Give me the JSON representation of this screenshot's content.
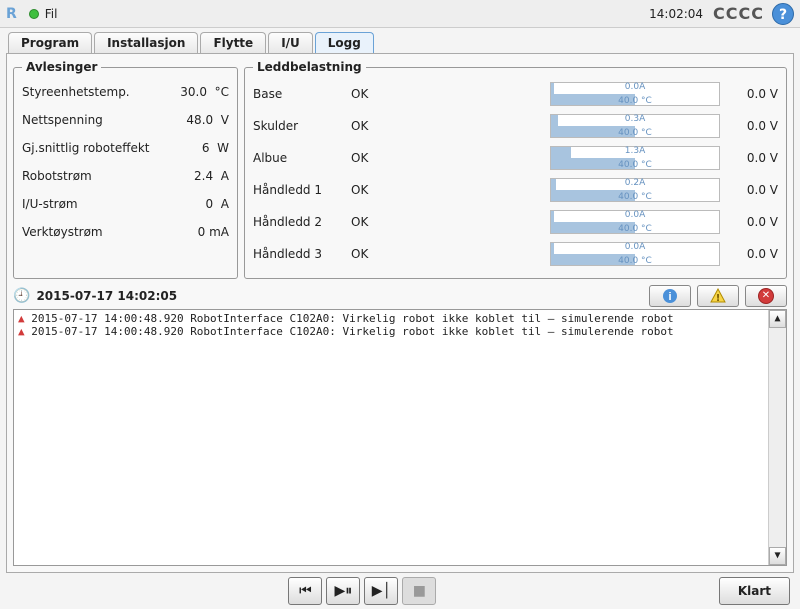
{
  "header": {
    "logo": "R",
    "menu_file": "Fil",
    "clock": "14:02:04",
    "brand": "CCCC",
    "help": "?"
  },
  "tabs": {
    "program": "Program",
    "installation": "Installasjon",
    "move": "Flytte",
    "io": "I/U",
    "log": "Logg"
  },
  "readings": {
    "title": "Avlesinger",
    "controller_temp_label": "Styreenhetstemp.",
    "controller_temp_value": "30.0",
    "controller_temp_unit": "°C",
    "main_voltage_label": "Nettspenning",
    "main_voltage_value": "48.0",
    "main_voltage_unit": "V",
    "avg_power_label": "Gj.snittlig roboteffekt",
    "avg_power_value": "6",
    "avg_power_unit": "W",
    "robot_current_label": "Robotstrøm",
    "robot_current_value": "2.4",
    "robot_current_unit": "A",
    "io_current_label": "I/U-strøm",
    "io_current_value": "0",
    "io_current_unit": "A",
    "tool_current_label": "Verktøystrøm",
    "tool_current_value": "0",
    "tool_current_unit": "mA"
  },
  "joints": {
    "title": "Leddbelastning",
    "rows": [
      {
        "name": "Base",
        "status": "OK",
        "amps": "0.0A",
        "temp": "40.0 °C",
        "amp_pct": 2,
        "temp_pct": 50,
        "volt": "0.0 V"
      },
      {
        "name": "Skulder",
        "status": "OK",
        "amps": "0.3A",
        "temp": "40.0 °C",
        "amp_pct": 4,
        "temp_pct": 50,
        "volt": "0.0 V"
      },
      {
        "name": "Albue",
        "status": "OK",
        "amps": "1.3A",
        "temp": "40.0 °C",
        "amp_pct": 12,
        "temp_pct": 50,
        "volt": "0.0 V"
      },
      {
        "name": "Håndledd 1",
        "status": "OK",
        "amps": "0.2A",
        "temp": "40.0 °C",
        "amp_pct": 3,
        "temp_pct": 50,
        "volt": "0.0 V"
      },
      {
        "name": "Håndledd 2",
        "status": "OK",
        "amps": "0.0A",
        "temp": "40.0 °C",
        "amp_pct": 2,
        "temp_pct": 50,
        "volt": "0.0 V"
      },
      {
        "name": "Håndledd 3",
        "status": "OK",
        "amps": "0.0A",
        "temp": "40.0 °C",
        "amp_pct": 2,
        "temp_pct": 50,
        "volt": "0.0 V"
      }
    ]
  },
  "logbar": {
    "icon": "🕘",
    "timestamp": "2015-07-17 14:02:05"
  },
  "log": {
    "lines": [
      "2015-07-17 14:00:48.920 RobotInterface C102A0: Virkelig robot ikke koblet til — simulerende robot",
      "2015-07-17 14:00:48.920 RobotInterface C102A0: Virkelig robot ikke koblet til — simulerende robot"
    ]
  },
  "playback": {
    "rewind": "⏮",
    "play_pause": "▶⏸",
    "fwd": "▶│",
    "stop": "■"
  },
  "footer": {
    "ready": "Klart"
  }
}
